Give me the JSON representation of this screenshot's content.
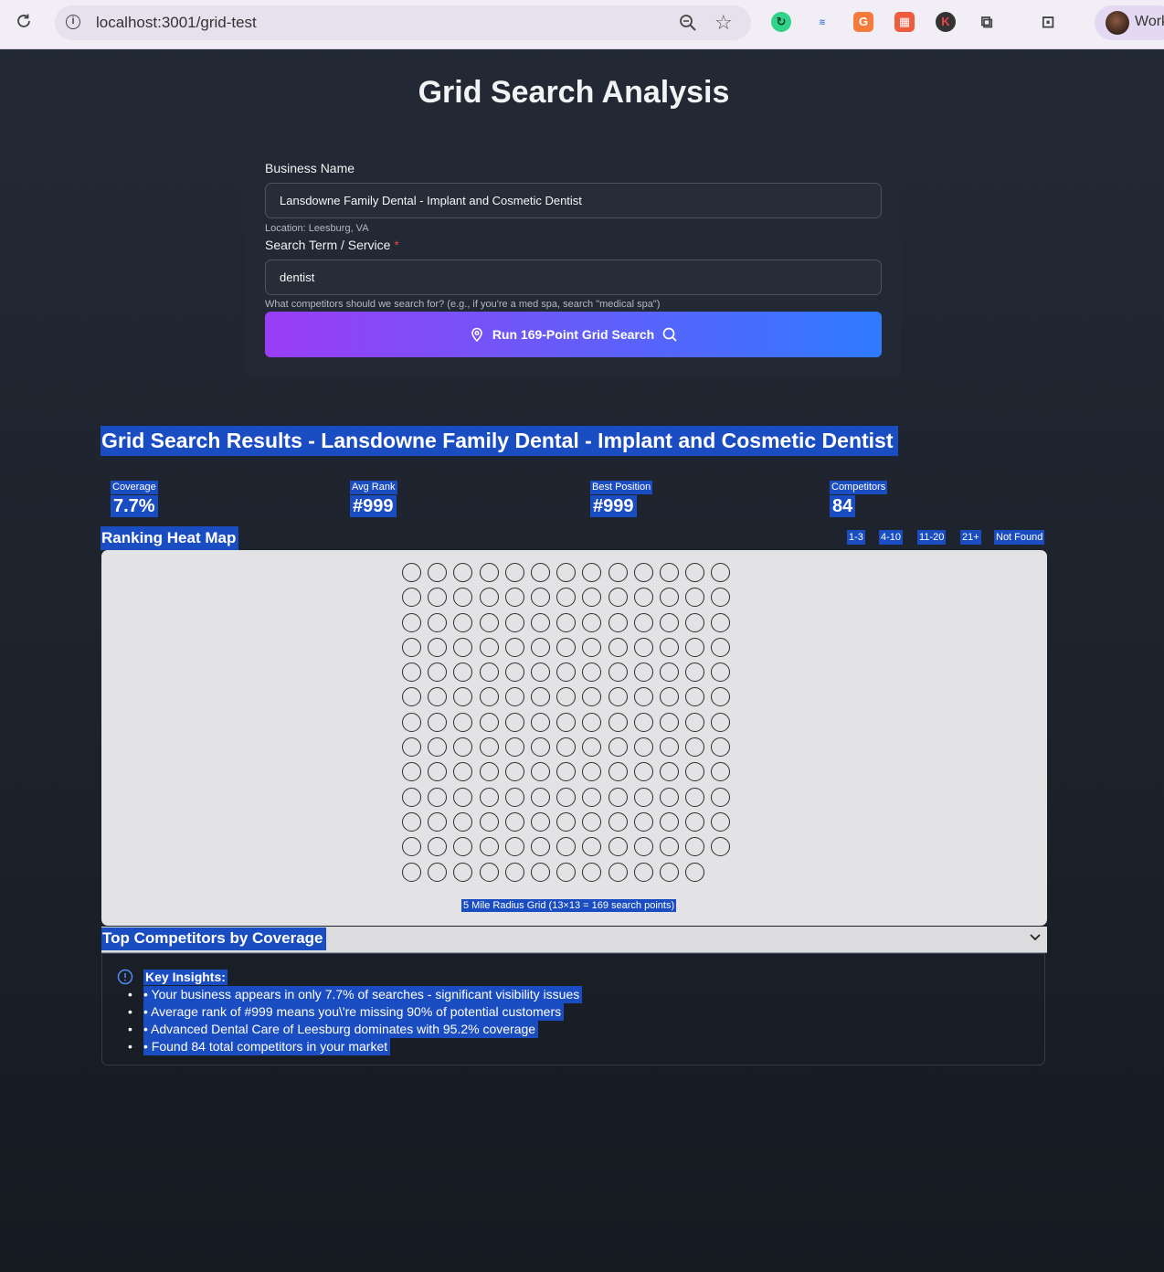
{
  "browser": {
    "url": "localhost:3001/grid-test",
    "profile_label": "Work"
  },
  "page": {
    "title": "Grid Search Analysis"
  },
  "form": {
    "business_label": "Business Name",
    "business_value": "Lansdowne Family Dental - Implant and Cosmetic Dentist",
    "location": "Location: Leesburg, VA",
    "search_label": "Search Term / Service",
    "required_mark": "*",
    "search_value": "dentist",
    "search_hint": "What competitors should we search for? (e.g., if you're a med spa, search \"medical spa\")",
    "run_button": "Run 169-Point Grid Search"
  },
  "results": {
    "title": "Grid Search Results - Lansdowne Family Dental - Implant and Cosmetic Dentist",
    "stats": [
      {
        "label": "Coverage",
        "value": "7.7%"
      },
      {
        "label": "Avg Rank",
        "value": "#999"
      },
      {
        "label": "Best Position",
        "value": "#999"
      },
      {
        "label": "Competitors",
        "value": "84"
      }
    ]
  },
  "heatmap": {
    "title": "Ranking Heat Map",
    "legend": [
      "1-3",
      "4-10",
      "11-20",
      "21+",
      "Not Found"
    ],
    "caption": "5 Mile Radius Grid (13×13 = 169 search points)",
    "grid_rows": 13,
    "grid_cols": 13,
    "points_shown": 168
  },
  "competitors": {
    "title": "Top Competitors by Coverage"
  },
  "insights": {
    "title": "Key Insights:",
    "items": [
      "• Your business appears in only 7.7% of searches - significant visibility issues",
      "• Average rank of #999 means you\\'re missing 90% of potential customers",
      "• Advanced Dental Care of Leesburg dominates with 95.2% coverage",
      "• Found 84 total competitors in your market"
    ]
  },
  "colors": {
    "background": "#1d222c",
    "selection": "#1b4dc2",
    "button_start": "#9b3df5",
    "button_end": "#2f7bff",
    "map_background": "#e3e3e5"
  }
}
